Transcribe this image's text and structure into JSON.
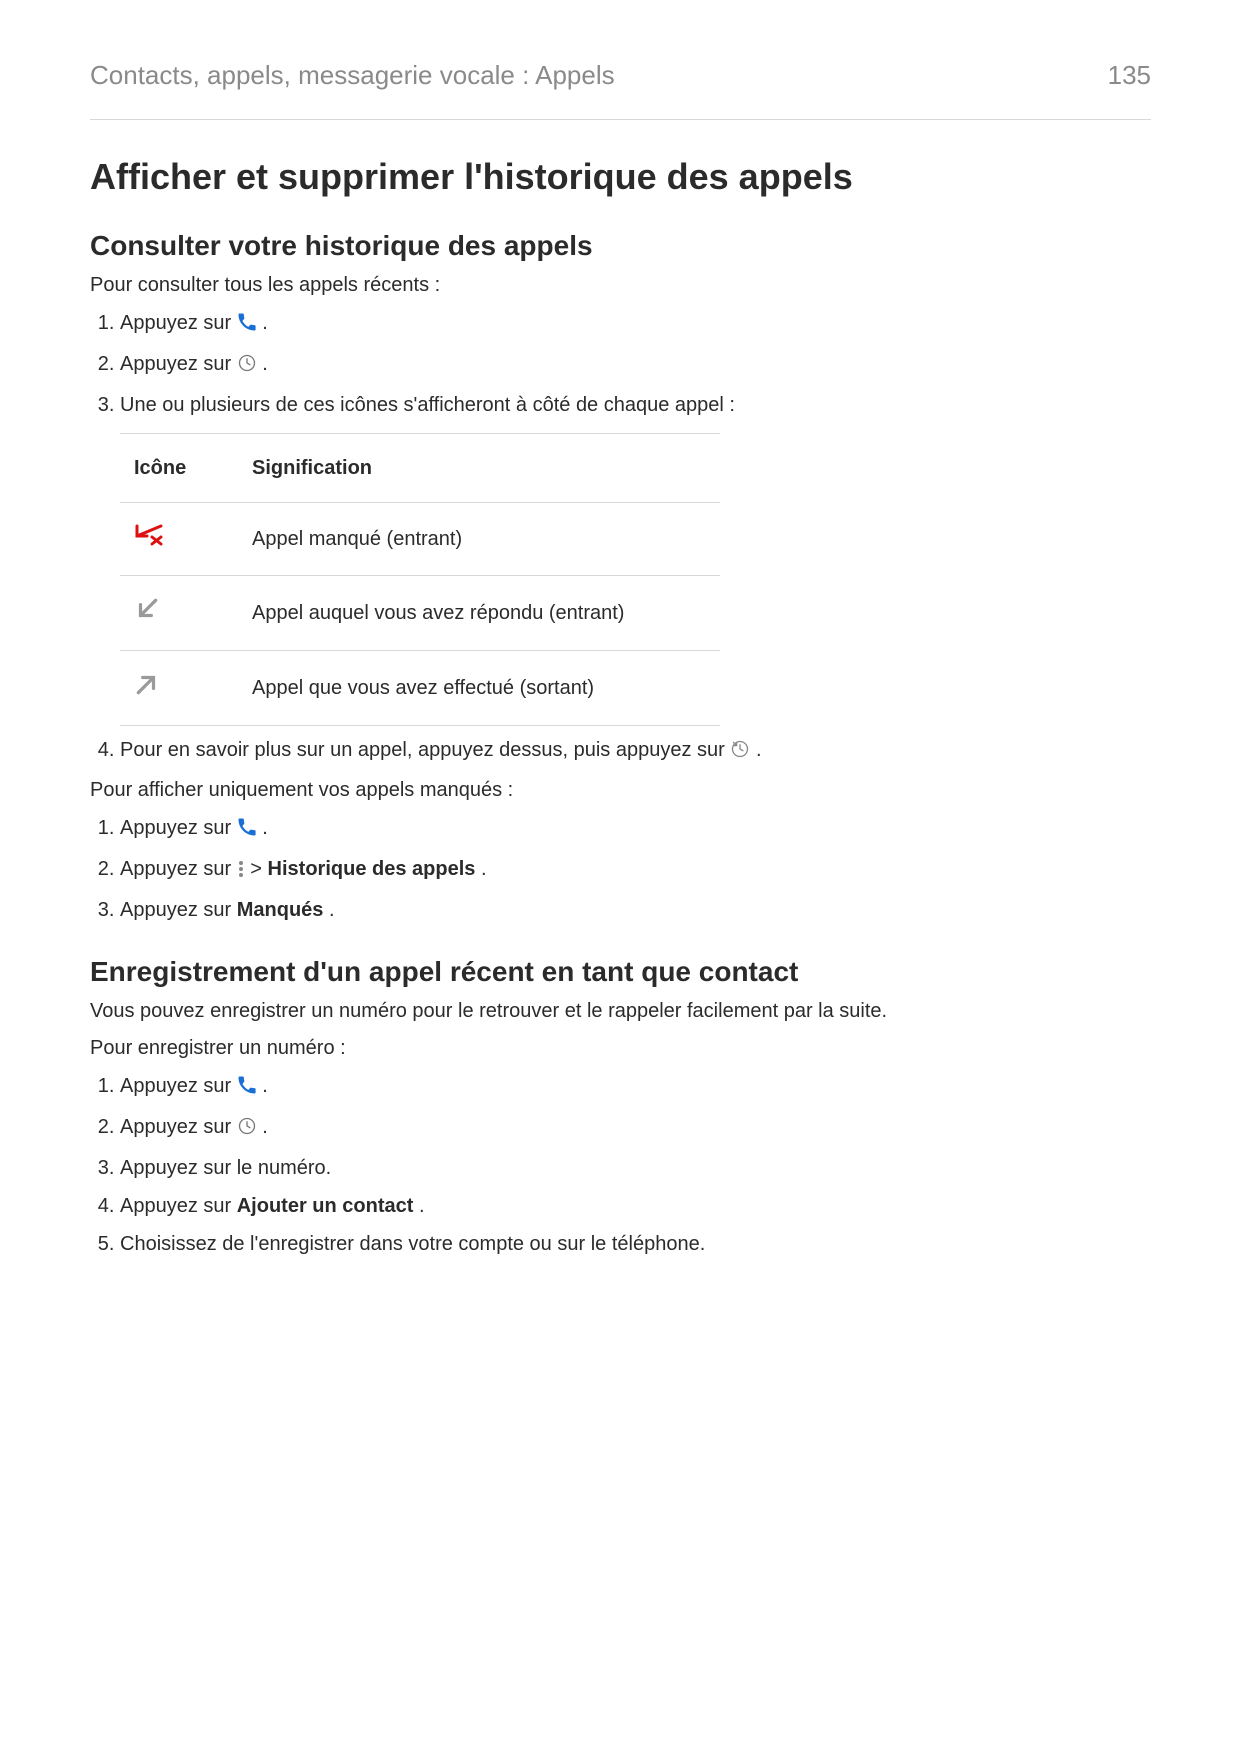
{
  "header": {
    "breadcrumb": "Contacts, appels, messagerie vocale : Appels",
    "page": "135"
  },
  "h1": "Afficher et supprimer l'historique des appels",
  "sec1": {
    "title": "Consulter votre historique des appels",
    "intro": "Pour consulter tous les appels récents :",
    "li1_a": "Appuyez sur ",
    "li1_b": ".",
    "li2_a": "Appuyez sur ",
    "li2_b": ".",
    "li3": "Une ou plusieurs de ces icônes s'afficheront à côté de chaque appel :",
    "table": {
      "hIcon": "Icône",
      "hMeaning": "Signification",
      "r1": "Appel manqué (entrant)",
      "r2": "Appel auquel vous avez répondu (entrant)",
      "r3": "Appel que vous avez effectué (sortant)"
    },
    "li4_a": "Pour en savoir plus sur un appel, appuyez dessus, puis appuyez sur ",
    "li4_b": ".",
    "intro2": "Pour afficher uniquement vos appels manqués :",
    "m1_a": "Appuyez sur ",
    "m1_b": ".",
    "m2_a": "Appuyez sur ",
    "m2_b": " > ",
    "m2_c": "Historique des appels",
    "m2_d": ".",
    "m3_a": "Appuyez sur ",
    "m3_b": "Manqués",
    "m3_c": "."
  },
  "sec2": {
    "title": "Enregistrement d'un appel récent en tant que contact",
    "p1": "Vous pouvez enregistrer un numéro pour le retrouver et le rappeler facilement par la suite.",
    "p2": "Pour enregistrer un numéro :",
    "li1_a": "Appuyez sur ",
    "li1_b": ".",
    "li2_a": "Appuyez sur ",
    "li2_b": ".",
    "li3": "Appuyez sur le numéro.",
    "li4_a": "Appuyez sur ",
    "li4_b": "Ajouter un contact",
    "li4_c": ".",
    "li5": "Choisissez de l'enregistrer dans votre compte ou sur le téléphone."
  }
}
